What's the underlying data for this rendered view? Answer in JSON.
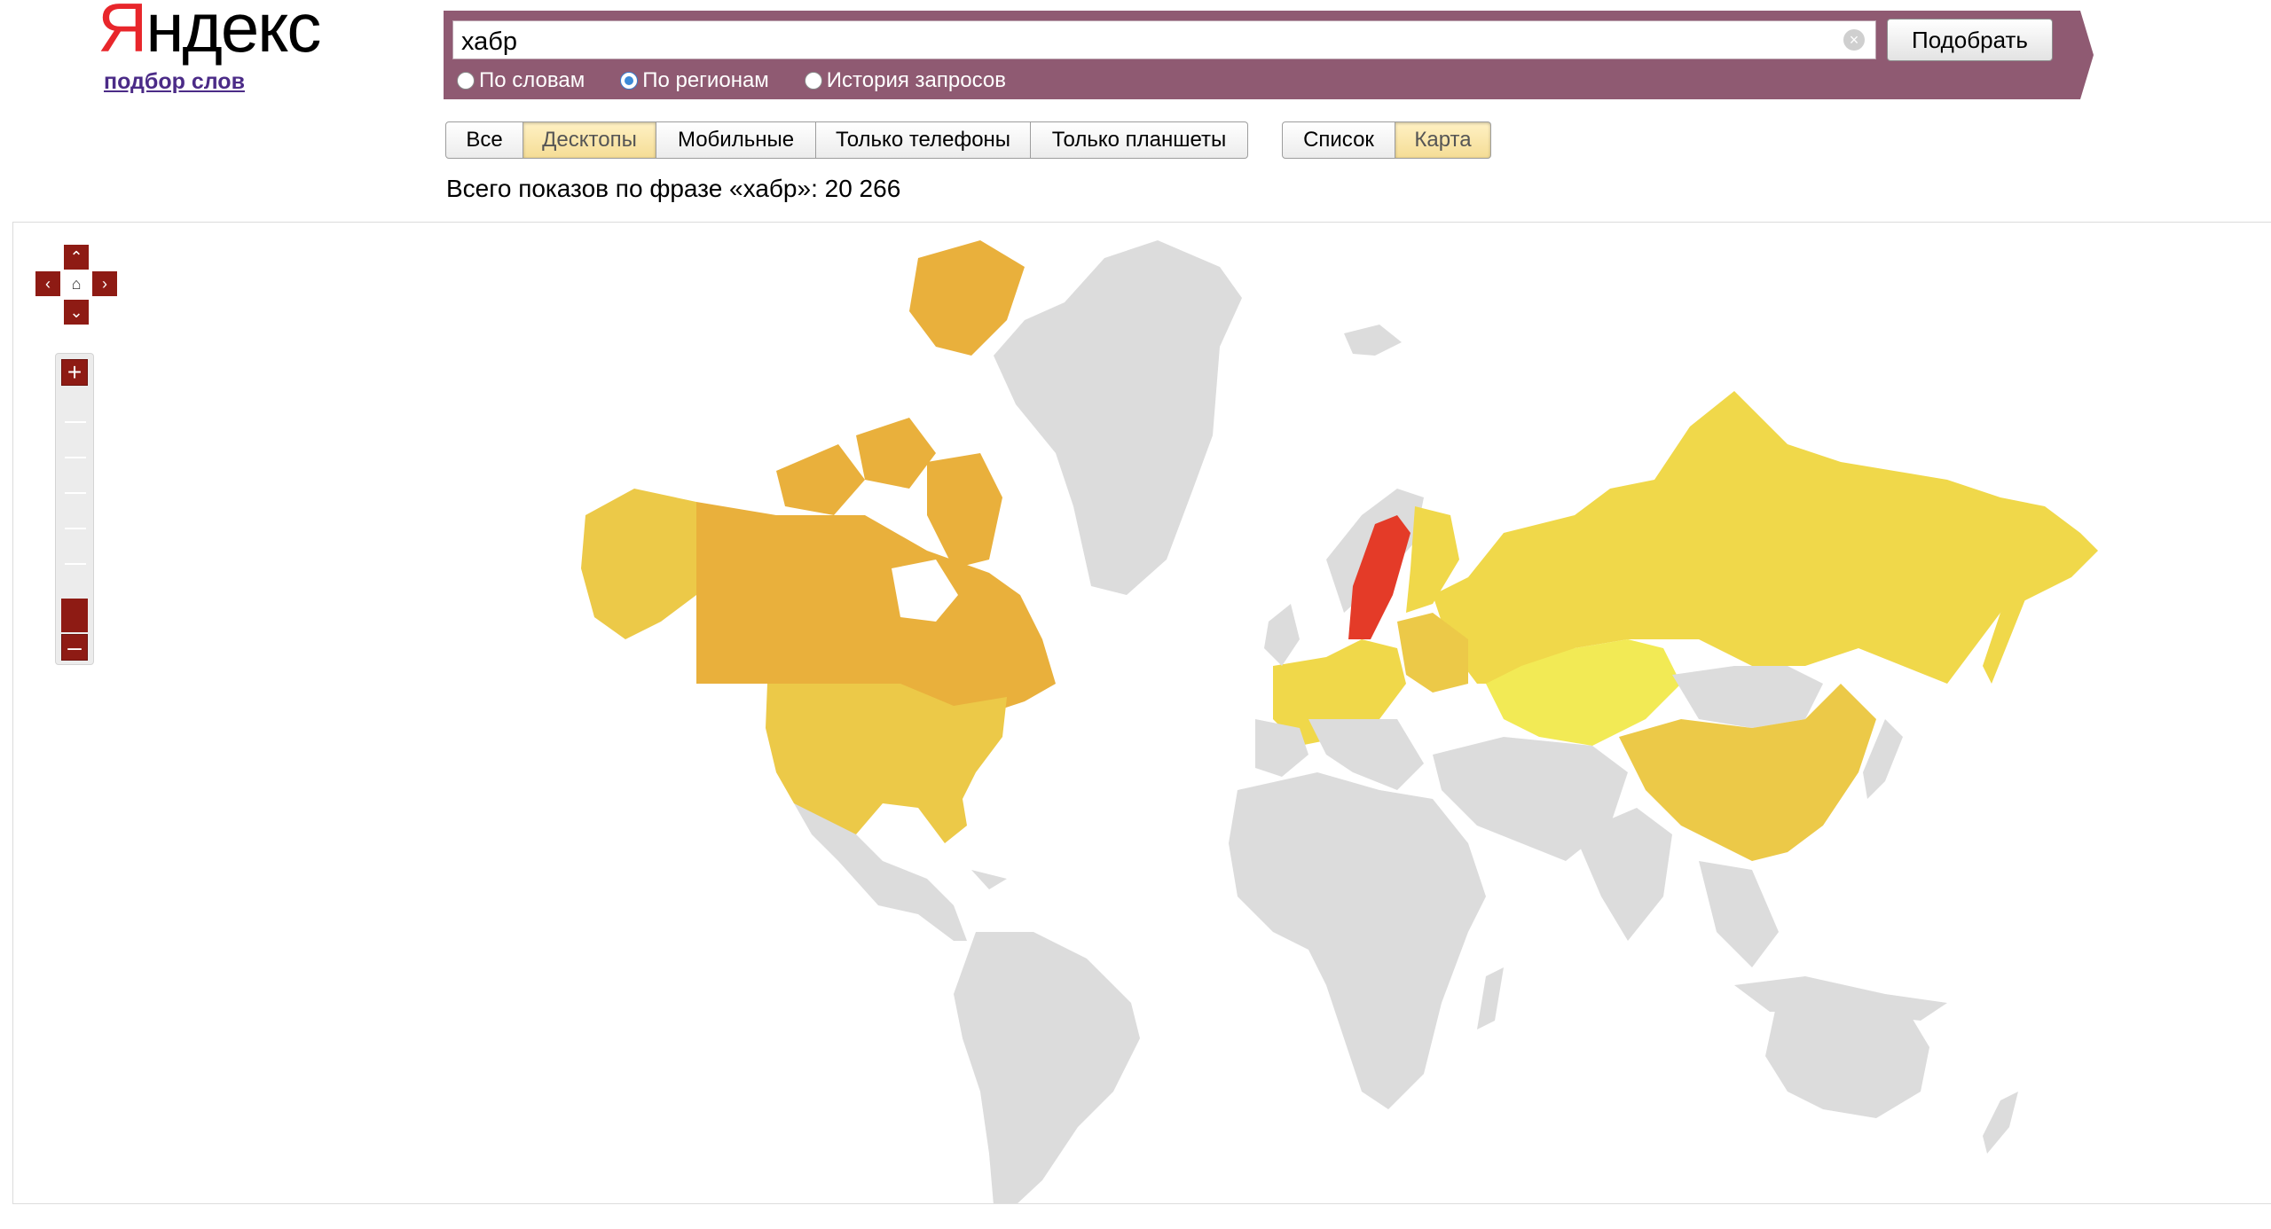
{
  "brand": {
    "logo_first": "Я",
    "logo_rest": "ндекс",
    "subtitle_link": "подбор слов"
  },
  "search": {
    "query": "хабр",
    "submit_label": "Подобрать",
    "clear_icon": "circle-x-icon"
  },
  "modes": [
    {
      "label": "По словам",
      "selected": false
    },
    {
      "label": "По регионам",
      "selected": true
    },
    {
      "label": "История запросов",
      "selected": false
    }
  ],
  "device_tabs": [
    {
      "label": "Все",
      "active": false
    },
    {
      "label": "Десктопы",
      "active": true
    },
    {
      "label": "Мобильные",
      "active": false
    },
    {
      "label": "Только телефоны",
      "active": false
    },
    {
      "label": "Только планшеты",
      "active": false
    }
  ],
  "view_tabs": [
    {
      "label": "Список",
      "active": false
    },
    {
      "label": "Карта",
      "active": true
    }
  ],
  "total_line": "Всего показов по фразе «хабр»: 20 266",
  "map_controls": {
    "pan_icons": [
      "arrow-up-icon",
      "arrow-left-icon",
      "home-icon",
      "arrow-right-icon",
      "arrow-down-icon"
    ],
    "zoom_in": "+",
    "zoom_out": "–"
  },
  "colors": {
    "band": "#8f5a72",
    "no_data": "#dcdcdc",
    "level_orange": "#e9b03c",
    "level_gold": "#ecc948",
    "level_yellow": "#f0d84a",
    "level_light": "#f2ea55",
    "level_red": "#e43b28"
  },
  "map_regions": [
    {
      "name": "Canada",
      "level": "orange"
    },
    {
      "name": "USA",
      "level": "gold"
    },
    {
      "name": "Russia",
      "level": "yellow"
    },
    {
      "name": "Kazakhstan",
      "level": "light"
    },
    {
      "name": "China",
      "level": "gold"
    },
    {
      "name": "Sweden",
      "level": "red"
    },
    {
      "name": "Greenland",
      "level": "none"
    }
  ]
}
